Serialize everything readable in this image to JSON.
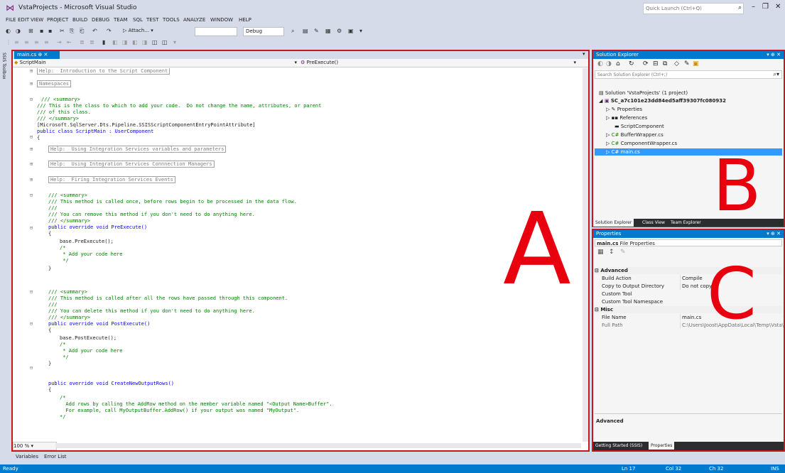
{
  "window": {
    "title": "VstaProjects - Microsoft Visual Studio",
    "quick_launch_placeholder": "Quick Launch (Ctrl+Q)"
  },
  "menu": [
    "FILE",
    "EDIT",
    "VIEW",
    "PROJECT",
    "BUILD",
    "DEBUG",
    "TEAM",
    "SQL",
    "TEST",
    "TOOLS",
    "ANALYZE",
    "WINDOW",
    "HELP"
  ],
  "toolbar": {
    "attach_label": "▷ Attach... ▾",
    "config": "Debug"
  },
  "toolbox_label": "SSIS Toolbox",
  "editor": {
    "tab": "main.cs",
    "nav_left": "ScriptMain",
    "nav_right": "PreExecute()",
    "zoom": "100 %",
    "lines": [
      "Help:  Introduction to the Script Component",
      "Namespaces",
      "/// <summary>",
      "/// This is the class to which to add your code.  Do not change the name, attributes, or parent",
      "/// of this class.",
      "/// </summary>",
      "[Microsoft.SqlServer.Dts.Pipeline.SSISScriptComponentEntryPointAttribute]",
      "public class ScriptMain : UserComponent",
      "{",
      "Help:  Using Integration Services variables and parameters",
      "Help:  Using Integration Services Connnection Managers",
      "Help:  Firing Integration Services Events",
      "/// <summary>",
      "/// This method is called once, before rows begin to be processed in the data flow.",
      "///",
      "/// You can remove this method if you don't need to do anything here.",
      "/// </summary>",
      "public override void PreExecute()",
      "{",
      "base.PreExecute();",
      "/*",
      " * Add your code here",
      " */",
      "}",
      "/// <summary>",
      "/// This method is called after all the rows have passed through this component.",
      "///",
      "/// You can delete this method if you don't need to do anything here.",
      "/// </summary>",
      "public override void PostExecute()",
      "{",
      "base.PostExecute();",
      "/*",
      " * Add your code here",
      " */",
      "}",
      "public override void CreateNewOutputRows()",
      "{",
      "/*",
      "  Add rows by calling the AddRow method on the member variable named \"<Output Name>Buffer\".",
      "  For example, call MyOutputBuffer.AddRow() if your output was named \"MyOutput\".",
      "*/"
    ]
  },
  "labels": {
    "a": "A",
    "b": "B",
    "c": "C"
  },
  "solution_explorer": {
    "title": "Solution Explorer",
    "search_placeholder": "Search Solution Explorer (Ctrl+;)",
    "tree": [
      "Solution 'VstaProjects' (1 project)",
      "SC_a7c101e23dd84ed5aff39307fc080932",
      "Properties",
      "References",
      "ScriptComponent",
      "BufferWrapper.cs",
      "ComponentWrapper.cs",
      "main.cs"
    ],
    "tabs": [
      "Solution Explorer",
      "Class View",
      "Team Explorer"
    ]
  },
  "properties": {
    "title": "Properties",
    "object": "main.cs",
    "object_type": "File Properties",
    "categories": [
      {
        "name": "Advanced",
        "rows": [
          {
            "name": "Build Action",
            "value": "Compile"
          },
          {
            "name": "Copy to Output Directory",
            "value": "Do not copy"
          },
          {
            "name": "Custom Tool",
            "value": ""
          },
          {
            "name": "Custom Tool Namespace",
            "value": ""
          }
        ]
      },
      {
        "name": "Misc",
        "rows": [
          {
            "name": "File Name",
            "value": "main.cs"
          },
          {
            "name": "Full Path",
            "value": "C:\\Users\\Joost\\AppData\\Local\\Temp\\Vsta\\"
          }
        ]
      }
    ],
    "description_title": "Advanced",
    "tabs": [
      "Getting Started (SSIS)",
      "Properties"
    ]
  },
  "bottom_tabs": [
    "Variables",
    "Error List"
  ],
  "status": {
    "ready": "Ready",
    "ln": "Ln 17",
    "col": "Col 32",
    "ch": "Ch 32",
    "ins": "INS"
  },
  "colors": {
    "accent": "#007acc",
    "annotation_red": "#e8000f"
  }
}
